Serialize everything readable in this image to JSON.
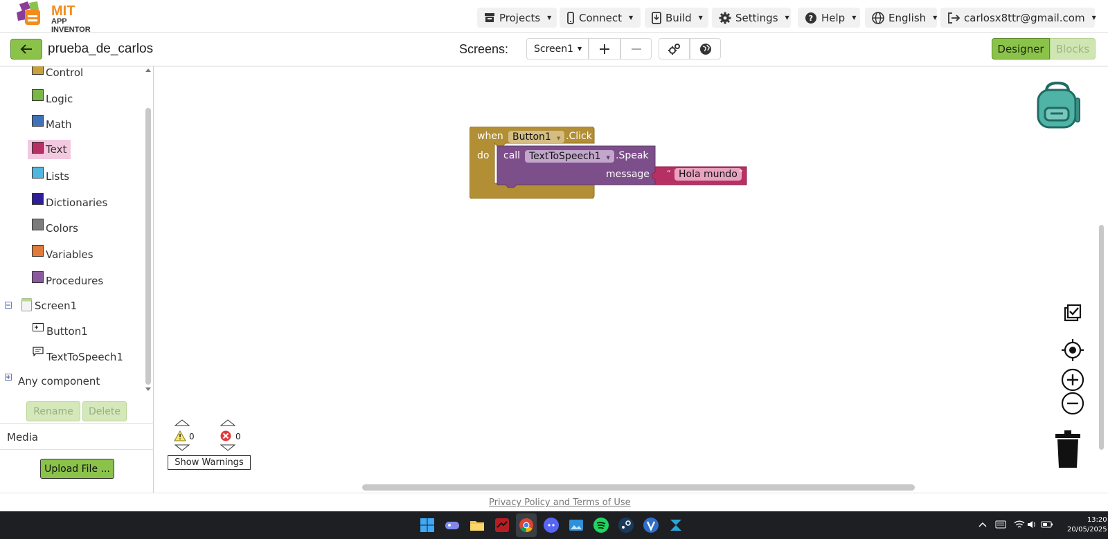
{
  "app": {
    "logo_title": "MIT",
    "logo_subtitle": "APP INVENTOR"
  },
  "menu": {
    "projects": "Projects",
    "connect": "Connect",
    "build": "Build",
    "settings": "Settings",
    "help": "Help",
    "language": "English",
    "account": "carlosx8ttr@gmail.com"
  },
  "project": {
    "name": "prueba_de_carlos"
  },
  "screens": {
    "label": "Screens:",
    "current": "Screen1"
  },
  "mode": {
    "designer": "Designer",
    "blocks": "Blocks"
  },
  "palette": {
    "categories": [
      {
        "label": "Control",
        "color": "#c8a13c"
      },
      {
        "label": "Logic",
        "color": "#7ab648"
      },
      {
        "label": "Math",
        "color": "#3f72b8"
      },
      {
        "label": "Text",
        "color": "#b73064"
      },
      {
        "label": "Lists",
        "color": "#52b7e0"
      },
      {
        "label": "Dictionaries",
        "color": "#2e1f98"
      },
      {
        "label": "Colors",
        "color": "#7c7c7c"
      },
      {
        "label": "Variables",
        "color": "#e07b3a"
      },
      {
        "label": "Procedures",
        "color": "#8b5a9c"
      }
    ],
    "screen": "Screen1",
    "components": [
      "Button1",
      "TextToSpeech1"
    ],
    "any_component": "Any component",
    "rename": "Rename",
    "delete": "Delete",
    "media": "Media",
    "upload": "Upload File ..."
  },
  "blocks": {
    "event_when": "when",
    "event_component": "Button1",
    "event_name": ".Click",
    "event_do": "do",
    "call": "call",
    "call_component": "TextToSpeech1",
    "call_method": ".Speak",
    "param": "message",
    "string_value": "Hola mundo",
    "colors": {
      "event": "#b28e34",
      "call": "#7d4f8a",
      "text": "#b73064"
    }
  },
  "warnings": {
    "warning_count": "0",
    "error_count": "0",
    "toggle": "Show Warnings"
  },
  "footer": {
    "link": "Privacy Policy and Terms of Use"
  },
  "system": {
    "time": "13:20",
    "date": "20/05/2025"
  },
  "accent": "#8bc34a"
}
